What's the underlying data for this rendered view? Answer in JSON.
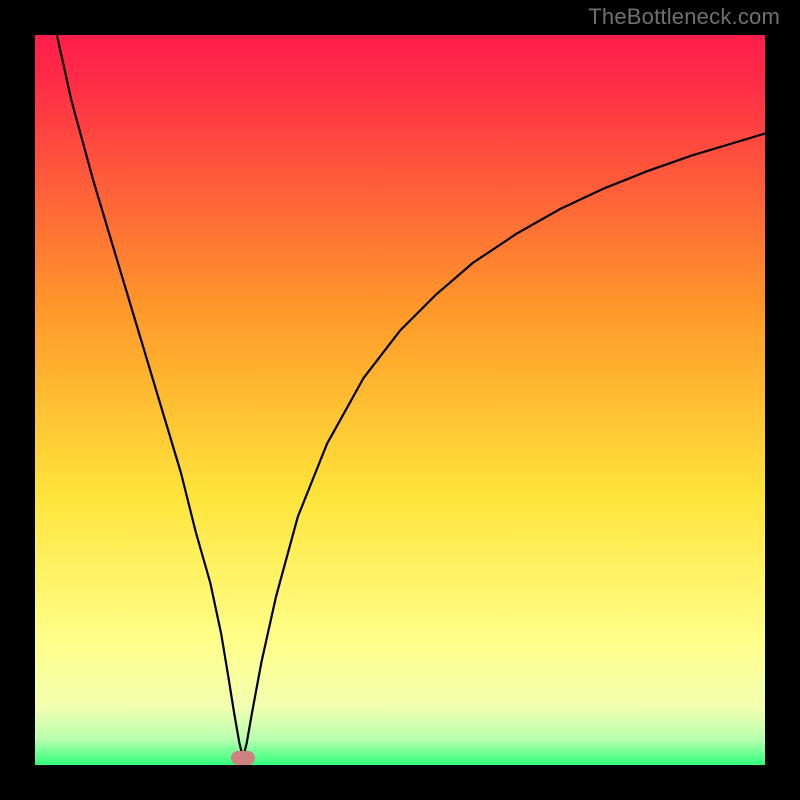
{
  "watermark": "TheBottleneck.com",
  "chart_data": {
    "type": "line",
    "title": "",
    "xlabel": "",
    "ylabel": "",
    "xlim": [
      0,
      100
    ],
    "ylim": [
      0,
      100
    ],
    "background_gradient": {
      "top": "#ff1e4b",
      "mid1": "#ff9a2a",
      "mid2": "#ffe43a",
      "mid3": "#ffff8a",
      "bottom": "#2fff7a"
    },
    "curve": {
      "note": "V-shaped curve with sharp cusp at minimum (~x=28.5, y=1) and asymptotic rise to both sides. Left branch approaches y≈100 near x≈3; right branch rises concavely toward y≈87 at x=100.",
      "x": [
        3,
        5,
        8,
        11,
        14,
        17,
        20,
        22,
        24,
        25.5,
        26.5,
        27.3,
        28,
        28.5,
        29,
        29.7,
        31,
        33,
        36,
        40,
        45,
        50,
        55,
        60,
        66,
        72,
        78,
        84,
        90,
        95,
        100
      ],
      "y": [
        100,
        91,
        80,
        70,
        60,
        50,
        40,
        32,
        25,
        18,
        12,
        7,
        3,
        1,
        3,
        7,
        14,
        23,
        34,
        44,
        53,
        59.5,
        64.5,
        68.8,
        72.8,
        76.2,
        79,
        81.4,
        83.5,
        85,
        86.5
      ]
    },
    "minimum_marker": {
      "x": 28.5,
      "y": 1,
      "color": "#cf8080"
    }
  }
}
